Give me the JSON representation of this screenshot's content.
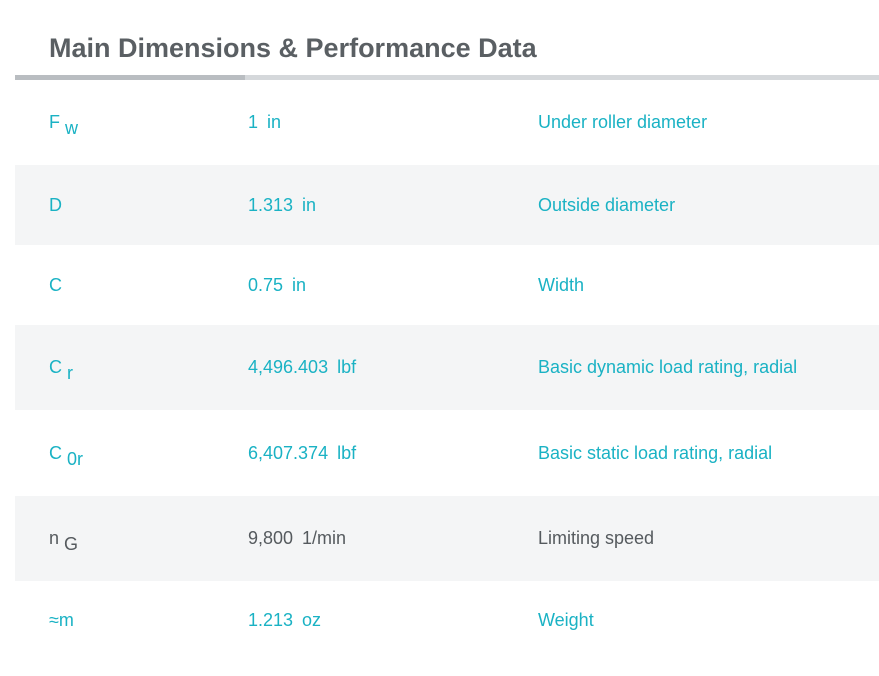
{
  "title": "Main Dimensions & Performance Data",
  "colors": {
    "accent": "#1ab2c4",
    "muted_text": "#555a5e",
    "title": "#5a5f63",
    "stripe": "#f4f5f6"
  },
  "rows": [
    {
      "symbol": "F",
      "sub": "w",
      "value": "1",
      "unit": "in",
      "description": "Under roller diameter"
    },
    {
      "symbol": "D",
      "sub": "",
      "value": "1.313",
      "unit": "in",
      "description": "Outside diameter"
    },
    {
      "symbol": "C",
      "sub": "",
      "value": "0.75",
      "unit": "in",
      "description": "Width"
    },
    {
      "symbol": "C",
      "sub": "r",
      "value": "4,496.403",
      "unit": "lbf",
      "description": "Basic dynamic load rating, radial"
    },
    {
      "symbol": "C",
      "sub": "0r",
      "value": "6,407.374",
      "unit": "lbf",
      "description": "Basic static load rating, radial"
    },
    {
      "symbol": "n",
      "sub": "G",
      "value": "9,800",
      "unit": "1/min",
      "description": "Limiting speed"
    },
    {
      "symbol": "≈m",
      "sub": "",
      "value": "1.213",
      "unit": "oz",
      "description": "Weight"
    }
  ]
}
